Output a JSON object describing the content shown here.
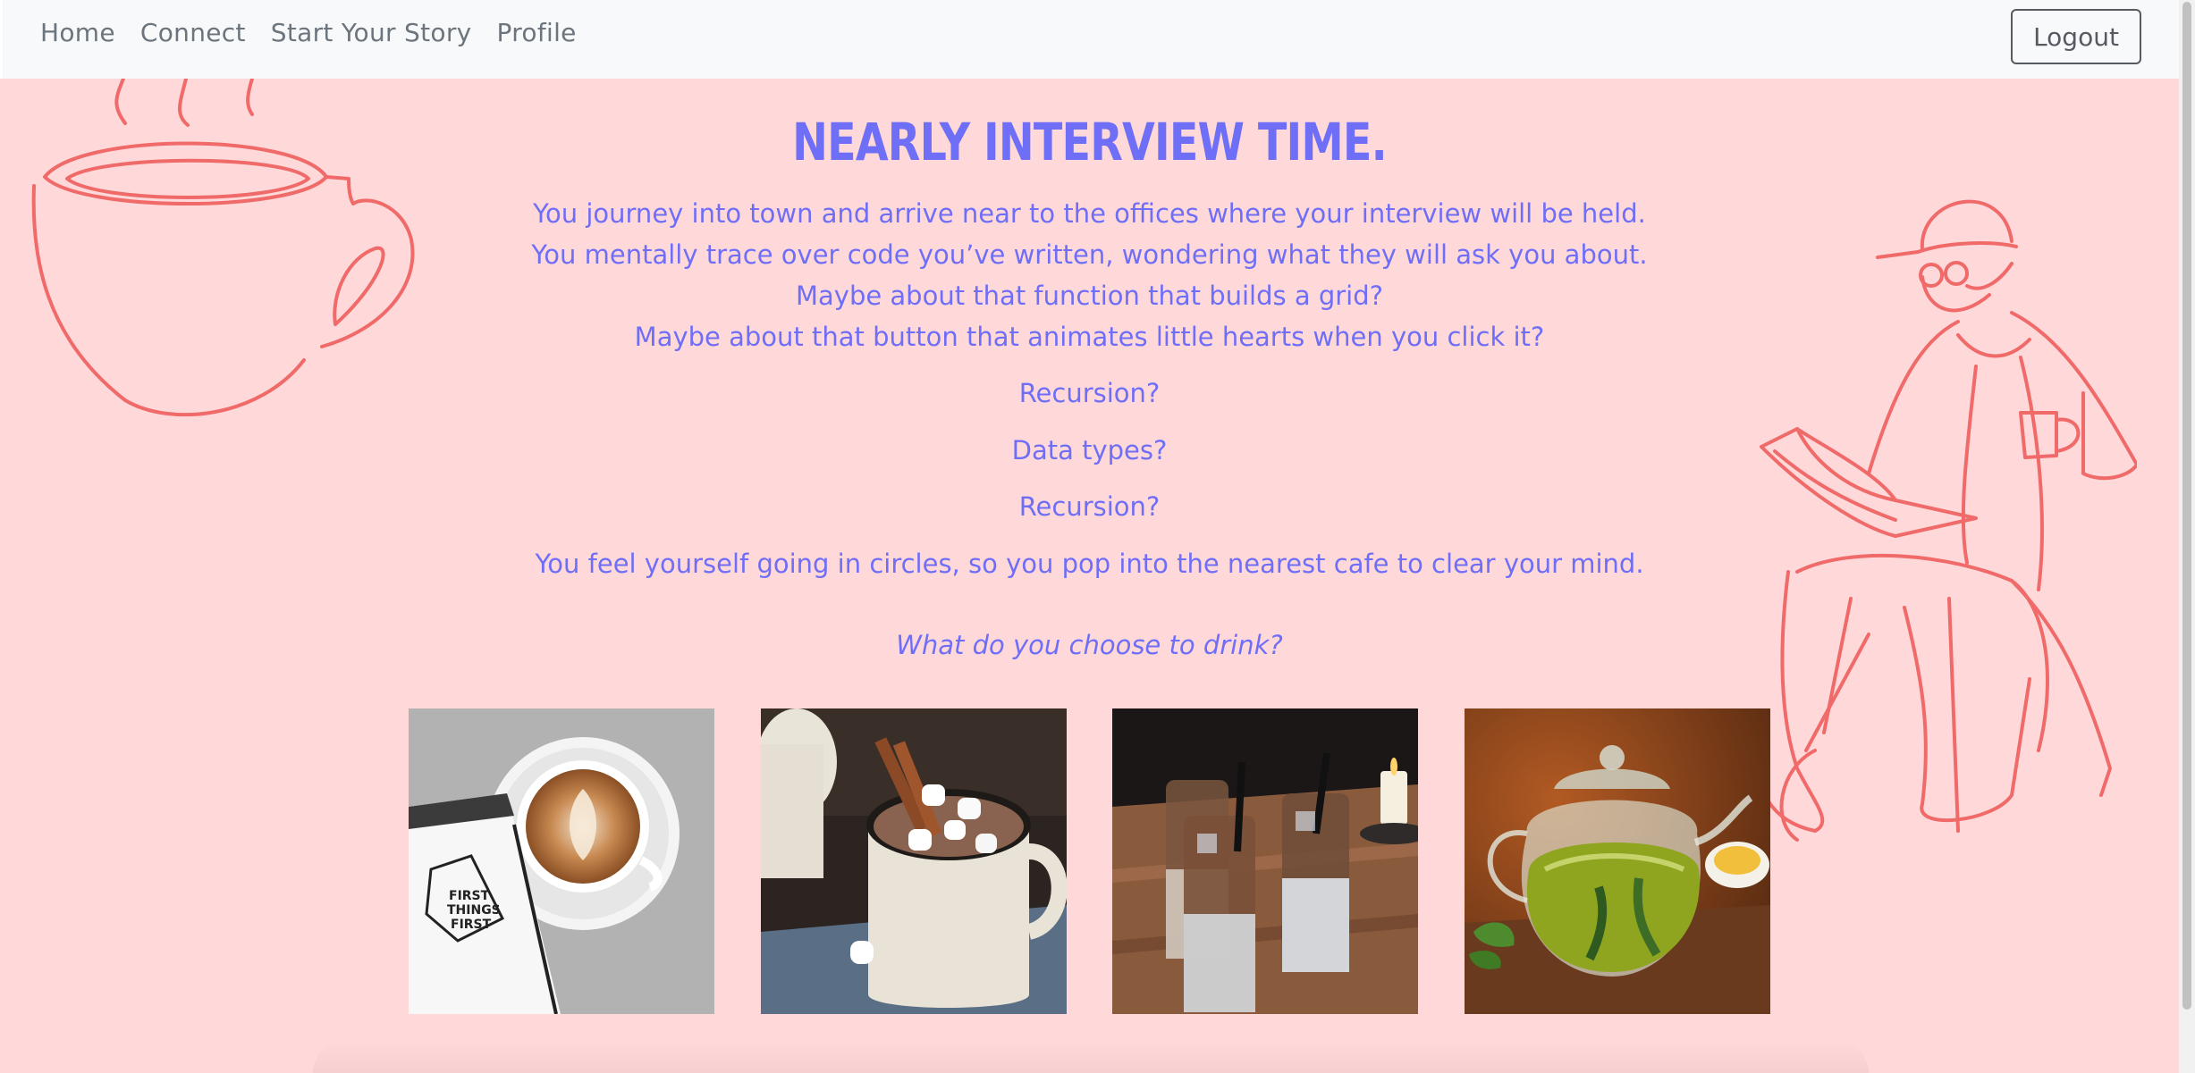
{
  "nav": {
    "links": [
      "Home",
      "Connect",
      "Start Your Story",
      "Profile"
    ],
    "logout_label": "Logout"
  },
  "story": {
    "title": "Nearly interview time.",
    "paragraphs": [
      "You journey into town and arrive near to the offices where your interview will be held.",
      "You mentally trace over code you’ve written, wondering what they will ask you about.",
      "Maybe about that function that builds a grid?",
      "Maybe about that button that animates little hearts when you click it?",
      "Recursion?",
      "Data types?",
      "Recursion?",
      "You feel yourself going in circles, so you pop into the nearest cafe to clear your mind."
    ],
    "question": "What do you choose to drink?"
  },
  "choices": [
    {
      "name": "latte",
      "book_text": "FIRST THINGS FIRST"
    },
    {
      "name": "hot-chocolate"
    },
    {
      "name": "iced-coffee"
    },
    {
      "name": "green-tea"
    }
  ],
  "colors": {
    "background": "#ffd9da",
    "accent": "#6f6ef7",
    "line_art": "#f06a6a",
    "navbar": "#f8f9fa",
    "nav_text": "#6c757d"
  }
}
